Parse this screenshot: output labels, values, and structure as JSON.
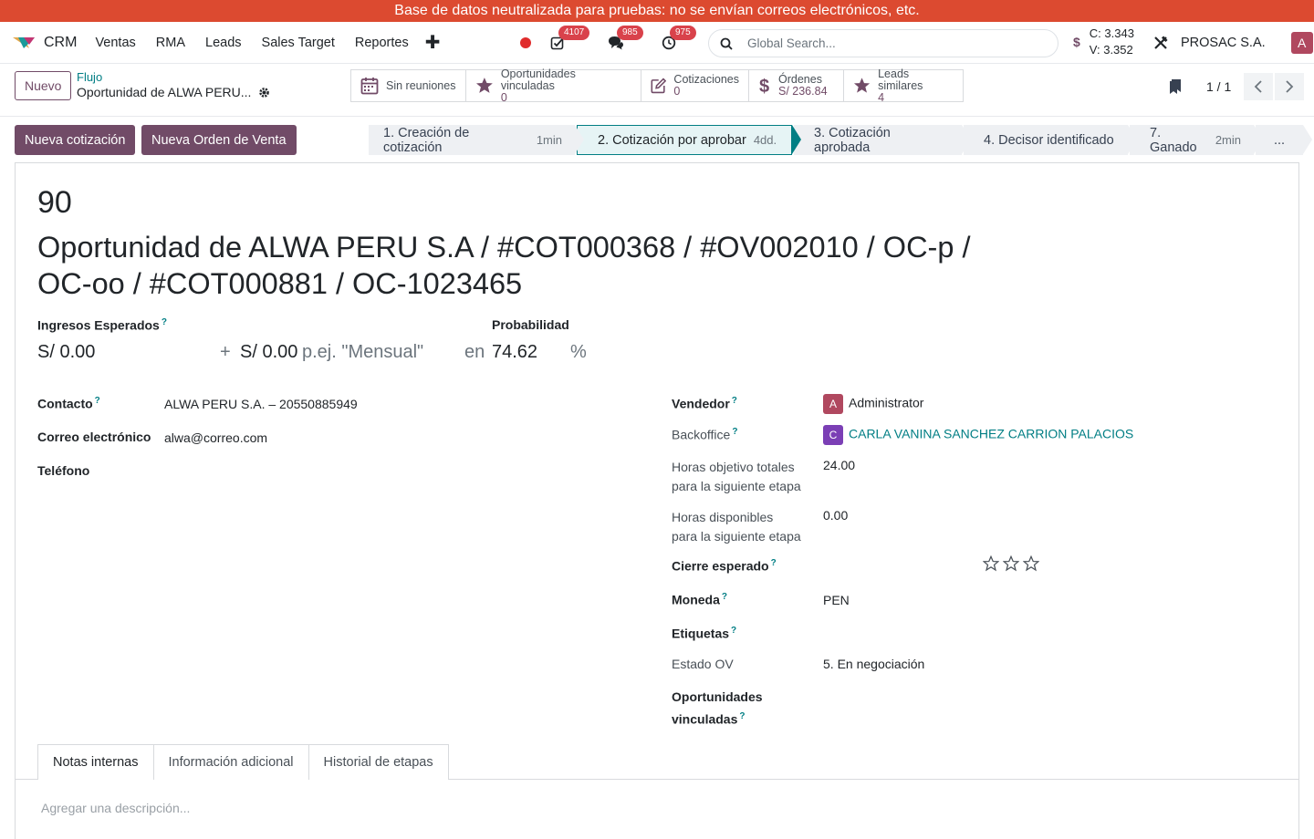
{
  "banner": {
    "text": "Base de datos neutralizada para pruebas: no se envían correos electrónicos, etc."
  },
  "navbar": {
    "app_name": "CRM",
    "menu": [
      "Ventas",
      "RMA",
      "Leads",
      "Sales Target",
      "Reportes"
    ],
    "plus": "✚",
    "badges": {
      "activities": "4107",
      "messages": "985",
      "timers": "975"
    },
    "search_placeholder": "Global Search...",
    "rate": {
      "symbol": "$",
      "compra": "C: 3.343",
      "venta": "V: 3.352"
    },
    "company": "PROSAC S.A.",
    "user_initial": "A",
    "colors": {
      "brand": "#714b67",
      "teal": "#017e84",
      "banner": "#dc4a30",
      "record": "#e02c2c"
    }
  },
  "control": {
    "new_label": "Nuevo",
    "breadcrumb_parent": "Flujo",
    "breadcrumb_current": "Oportunidad de ALWA PERU...",
    "smart_buttons": [
      {
        "icon": "calendar-icon",
        "label": "Sin reuniones",
        "value": ""
      },
      {
        "icon": "star-icon",
        "label": "Oportunidades vinculadas",
        "value": "0"
      },
      {
        "icon": "edit-icon",
        "label": "Cotizaciones",
        "value": "0"
      },
      {
        "icon": "dollar-icon",
        "label": "Órdenes",
        "value": "S/ 236.84"
      },
      {
        "icon": "star-icon",
        "label": "Leads similares",
        "value": "4"
      }
    ],
    "pager": "1 / 1"
  },
  "actions": {
    "new_quote": "Nueva cotización",
    "new_order": "Nueva Orden de Venta"
  },
  "stages": [
    {
      "label": "1. Creación de cotización",
      "duration": "1min",
      "active": false
    },
    {
      "label": "2. Cotización por aprobar",
      "duration": "4dd.",
      "active": true
    },
    {
      "label": "3. Cotización aprobada",
      "duration": "",
      "active": false
    },
    {
      "label": "4. Decisor identificado",
      "duration": "",
      "active": false
    },
    {
      "label": "7. Ganado",
      "duration": "2min",
      "active": false
    },
    {
      "label": "...",
      "duration": "",
      "active": false
    }
  ],
  "form": {
    "priority": "90",
    "title": "Oportunidad de ALWA PERU S.A / #COT000368 / #OV002010 / OC-p / OC-oo / #COT000881 / OC-1023465",
    "expected_revenue_label": "Ingresos Esperados",
    "expected_revenue": "S/ 0.00",
    "plus_sign": "+",
    "recurring_revenue": "S/ 0.00",
    "recurring_placeholder": "p.ej. \"Mensual\"",
    "at_label": "en",
    "probability_label": "Probabilidad",
    "probability": "74.62",
    "percent": "%",
    "contact_label": "Contacto",
    "contact": "ALWA PERU S.A. – 20550885949",
    "email_label": "Correo electrónico",
    "email": "alwa@correo.com",
    "phone_label": "Teléfono",
    "salesperson_label": "Vendedor",
    "salesperson": "Administrator",
    "salesperson_initial": "A",
    "backoffice_label": "Backoffice",
    "backoffice": "CARLA VANINA SANCHEZ CARRION PALACIOS",
    "backoffice_initial": "C",
    "target_hours_label_1": "Horas objetivo totales",
    "target_hours_label_2": "para la siguiente etapa",
    "target_hours": "24.00",
    "available_hours_label_1": "Horas disponibles",
    "available_hours_label_2": "para la siguiente etapa",
    "available_hours": "0.00",
    "expected_close_label": "Cierre esperado",
    "stars": 0,
    "currency_label": "Moneda",
    "currency": "PEN",
    "tags_label": "Etiquetas",
    "ov_state_label": "Estado OV",
    "ov_state": "5. En negociación",
    "linked_opps_label_1": "Oportunidades",
    "linked_opps_label_2": "vinculadas"
  },
  "tabs": [
    "Notas internas",
    "Información adicional",
    "Historial de etapas"
  ],
  "description_placeholder": "Agregar una descripción..."
}
